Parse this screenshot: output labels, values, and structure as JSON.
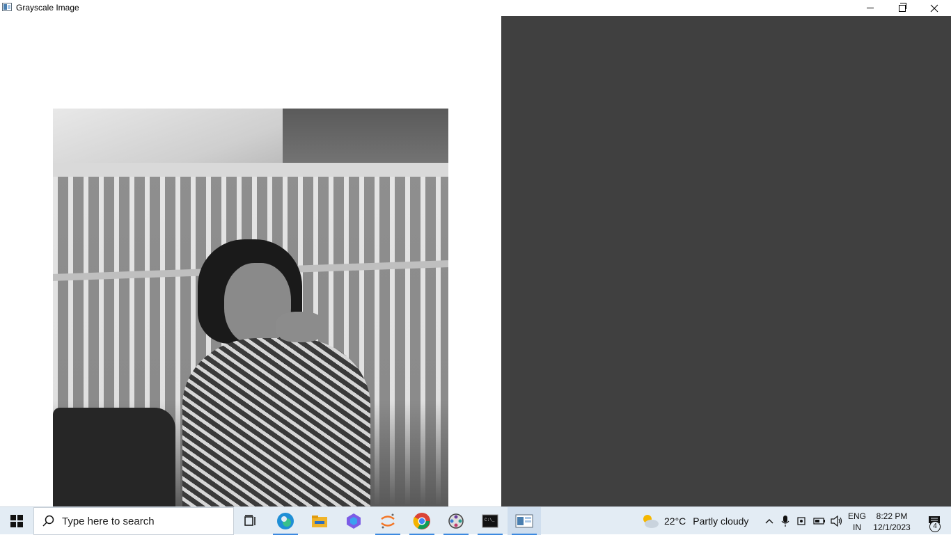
{
  "window": {
    "title": "Grayscale Image",
    "minimize_icon": "minimize-icon",
    "maximize_icon": "restore-icon",
    "close_icon": "close-icon"
  },
  "image": {
    "description_icon": "grayscale-photo"
  },
  "taskbar": {
    "search_placeholder": "Type here to search",
    "apps": [
      "task-view",
      "edge",
      "file-explorer",
      "copilot",
      "jupyter",
      "chrome",
      "media-app",
      "terminal",
      "image-viewer"
    ],
    "weather": {
      "temperature": "22°C",
      "condition": "Partly cloudy"
    },
    "language": {
      "line1": "ENG",
      "line2": "IN"
    },
    "clock": {
      "time": "8:22 PM",
      "date": "12/1/2023"
    },
    "notifications_count": "4"
  },
  "colors": {
    "taskbar_bg": "#e3ecf4",
    "dark_panel": "#404040",
    "accent": "#3d8ae0"
  }
}
